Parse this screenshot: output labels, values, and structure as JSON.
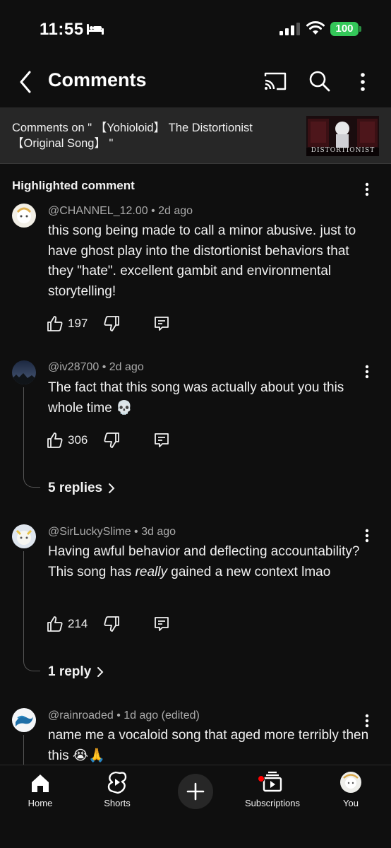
{
  "status_bar": {
    "time": "11:55",
    "battery": "100"
  },
  "header": {
    "title": "Comments"
  },
  "video_banner": {
    "text": "Comments on \" 【Yohioloid】 The Distortionist 【Original Song】 \"",
    "thumb_text": "DISTORTIONIST"
  },
  "highlighted_heading": "Highlighted comment",
  "comments": [
    {
      "author_meta": "@CHANNEL_12.00 • 2d ago",
      "text": "this song being made to call a minor abusive. just to have ghost play into the distortionist behaviors that they \"hate\". excellent gambit and environmental storytelling!",
      "likes": "197"
    },
    {
      "author_meta": "@iv28700 • 2d ago",
      "text": "The fact that this song was actually about you this whole time 💀",
      "likes": "306",
      "replies": "5 replies"
    },
    {
      "author_meta": "@SirLuckySlime • 3d ago",
      "text_before": "Having awful behavior and deflecting accountability? This song has ",
      "text_em": "really",
      "text_after": " gained a new context lmao",
      "likes": "214",
      "replies": "1 reply"
    },
    {
      "author_meta": "@rainroaded • 1d ago (edited)",
      "text": "name me a vocaloid song that aged more terribly then this 😭🙏"
    }
  ],
  "nav": {
    "home": "Home",
    "shorts": "Shorts",
    "subscriptions": "Subscriptions",
    "you": "You"
  },
  "icons": {
    "back": "chevron-left-icon",
    "cast": "cast-icon",
    "search": "search-icon",
    "more": "more-vertical-icon",
    "like": "thumbs-up-icon",
    "dislike": "thumbs-down-icon",
    "reply": "reply-icon",
    "home": "home-icon",
    "shorts": "shorts-icon",
    "create": "plus-icon",
    "subscriptions": "subscriptions-icon"
  },
  "colors": {
    "background": "#0f0f0f",
    "banner": "#272727",
    "battery": "#34c759",
    "notification_dot": "#ff0000",
    "secondary_text": "#aaaaaa"
  }
}
